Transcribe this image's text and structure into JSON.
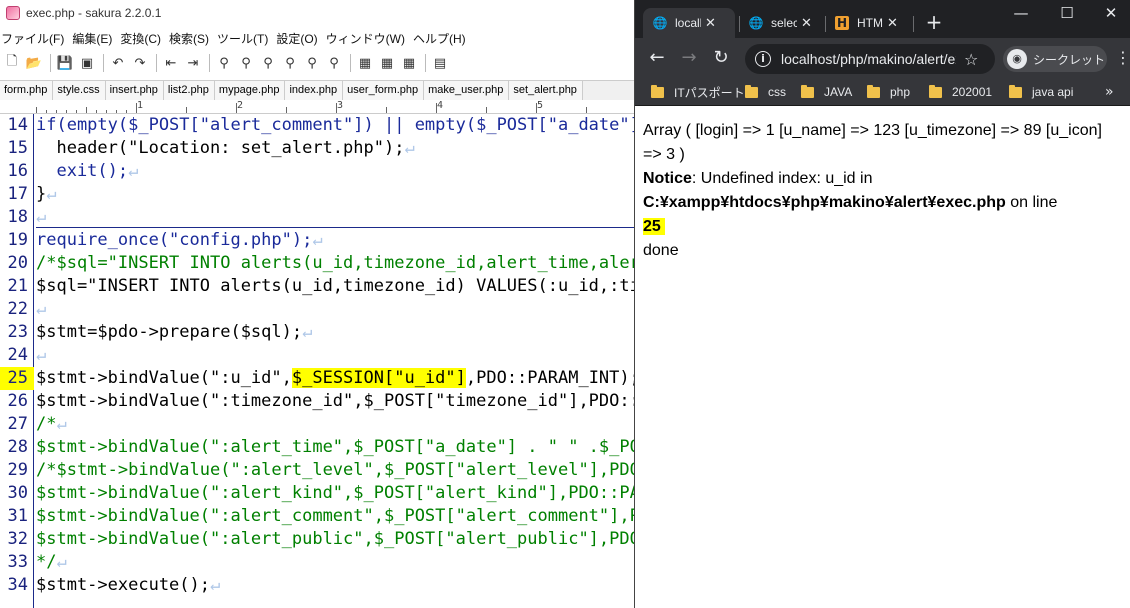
{
  "editor": {
    "title": "exec.php - sakura 2.2.0.1",
    "menu": [
      "ファイル(F)",
      "編集(E)",
      "変換(C)",
      "検索(S)",
      "ツール(T)",
      "設定(O)",
      "ウィンドウ(W)",
      "ヘルプ(H)"
    ],
    "tabs": [
      "form.php",
      "style.css",
      "insert.php",
      "list2.php",
      "mypage.php",
      "index.php",
      "user_form.php",
      "make_user.php",
      "set_alert.php"
    ],
    "ruler": [
      "1",
      "2",
      "3",
      "4",
      "5"
    ],
    "line_numbers": [
      "14",
      "15",
      "16",
      "17",
      "18",
      "19",
      "20",
      "21",
      "22",
      "23",
      "24",
      "25",
      "26",
      "27",
      "28",
      "29",
      "30",
      "31",
      "32",
      "33",
      "34",
      ""
    ],
    "highlighted_line": "25",
    "code": {
      "l14": "if(empty($_POST[\"alert_comment\"]) || empty($_POST[\"a_date\"])",
      "l15": "  header(\"Location: set_alert.php\");",
      "l16": "  exit();",
      "l17": "}",
      "l18": "",
      "l19": "require_once(\"config.php\");",
      "l20": "/*$sql=\"INSERT INTO alerts(u_id,timezone_id,alert_time,alert",
      "l21": "$sql=\"INSERT INTO alerts(u_id,timezone_id) VALUES(:u_id,:tim",
      "l22": "",
      "l23": "$stmt=$pdo->prepare($sql);",
      "l24": "",
      "l25a": "$stmt->bindValue(\":u_id\",",
      "l25b": "$_SESSION[\"u_id\"]",
      "l25c": ",PDO::PARAM_INT);",
      "l26": "$stmt->bindValue(\":timezone_id\",$_POST[\"timezone_id\"],PDO::P",
      "l27": "/*",
      "l28": "$stmt->bindValue(\":alert_time\",$_POST[\"a_date\"] . \" \" .$_POS",
      "l29": "/*$stmt->bindValue(\":alert_level\",$_POST[\"alert_level\"],PDO:",
      "l30": "$stmt->bindValue(\":alert_kind\",$_POST[\"alert_kind\"],PDO::PAR",
      "l31": "$stmt->bindValue(\":alert_comment\",$_POST[\"alert_comment\"],PD",
      "l32": "$stmt->bindValue(\":alert_public\",$_POST[\"alert_public\"],PDO:",
      "l33": "*/",
      "l34": "$stmt->execute();"
    },
    "newline_mark": "↵"
  },
  "browser": {
    "tabs": [
      {
        "label": "localhost",
        "icon": "globe-icon",
        "active": true
      },
      {
        "label": "select",
        "icon": "globe-icon",
        "active": false
      },
      {
        "label": "HTML",
        "icon": "html-icon",
        "active": false
      }
    ],
    "new_tab": "+",
    "url": "localhost/php/makino/alert/exec.php",
    "incognito_label": "シークレット",
    "bookmarks": [
      "ITパスポート",
      "css",
      "JAVA",
      "php",
      "202001",
      "java api"
    ],
    "output": {
      "line1": "Array ( [login] => 1 [u_name] => 123 [u_timezone] => 89 [u_icon] => 3 )",
      "notice_label": "Notice",
      "notice_text": ": Undefined index: u_id in",
      "path": "C:¥xampp¥htdocs¥php¥makino¥alert¥exec.php",
      "on_line": " on line",
      "line_no": "25",
      "done": "done"
    }
  }
}
